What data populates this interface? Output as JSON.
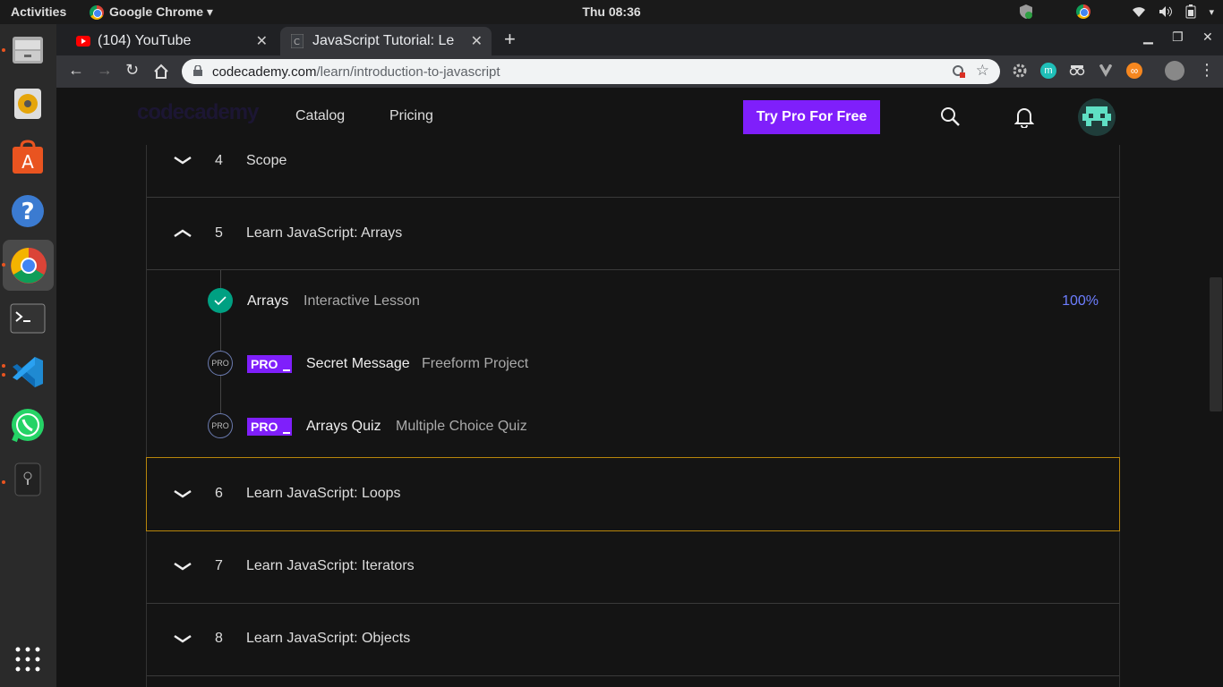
{
  "topbar": {
    "activities": "Activities",
    "app_name": "Google Chrome ▾",
    "clock": "Thu 08:36"
  },
  "tabs": [
    {
      "label": "(104) YouTube"
    },
    {
      "label": "JavaScript Tutorial: Le"
    }
  ],
  "address": {
    "host": "codecademy.com",
    "path": "/learn/introduction-to-javascript"
  },
  "header": {
    "nav_catalog": "Catalog",
    "nav_pricing": "Pricing",
    "pro_button": "Try Pro For Free",
    "logo": "codecademy"
  },
  "modules": [
    {
      "num": "4",
      "title": "Scope",
      "expanded": false
    },
    {
      "num": "5",
      "title": "Learn JavaScript: Arrays",
      "expanded": true
    },
    {
      "num": "6",
      "title": "Learn JavaScript: Loops",
      "expanded": false
    },
    {
      "num": "7",
      "title": "Learn JavaScript: Iterators",
      "expanded": false
    },
    {
      "num": "8",
      "title": "Learn JavaScript: Objects",
      "expanded": false
    }
  ],
  "lessons": [
    {
      "name": "Arrays",
      "type": "Interactive Lesson",
      "progress": "100%",
      "pro": false,
      "done": true
    },
    {
      "name": "Secret Message",
      "type": "Freeform Project",
      "pro": true,
      "badge": "PRO",
      "circle": "PRO"
    },
    {
      "name": "Arrays Quiz",
      "type": "Multiple Choice Quiz",
      "pro": true,
      "badge": "PRO",
      "circle": "PRO"
    }
  ],
  "colors": {
    "accent": "#7f1ffb",
    "check": "#00a082",
    "progress": "#6d7eff",
    "focus_border": "#b8860b"
  }
}
